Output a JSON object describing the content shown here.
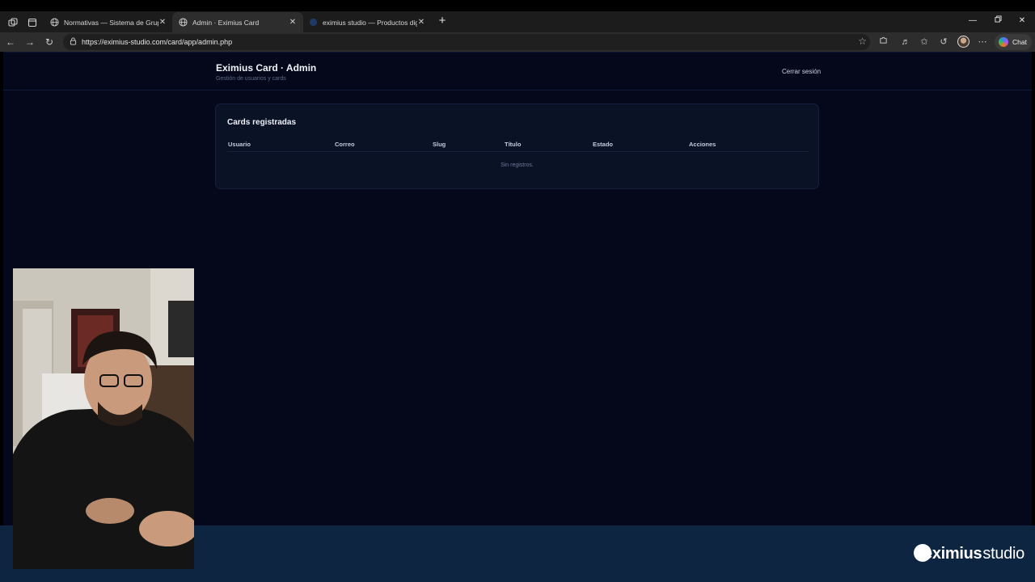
{
  "browser": {
    "tabs": [
      {
        "title": "Normativas — Sistema de Grupos",
        "active": false
      },
      {
        "title": "Admin · Eximius Card",
        "active": true
      },
      {
        "title": "eximius studio — Productos digit",
        "active": false
      }
    ],
    "url": "https://eximius-studio.com/card/app/admin.php",
    "chat_label": "Chat"
  },
  "app": {
    "title": "Eximius Card · Admin",
    "subtitle": "Gestión de usuarios y cards",
    "logout_label": "Cerrar sesión"
  },
  "cards_panel": {
    "title": "Cards registradas",
    "columns": [
      "Usuario",
      "Correo",
      "Slug",
      "Título",
      "Estado",
      "Acciones"
    ],
    "empty_message": "Sin registros."
  },
  "banner": {
    "brand_bold": "eximius",
    "brand_light": "studio"
  },
  "colors": {
    "page_bg": "#04081a",
    "card_bg": "#0a1226",
    "banner_bg": "#0d2540"
  }
}
